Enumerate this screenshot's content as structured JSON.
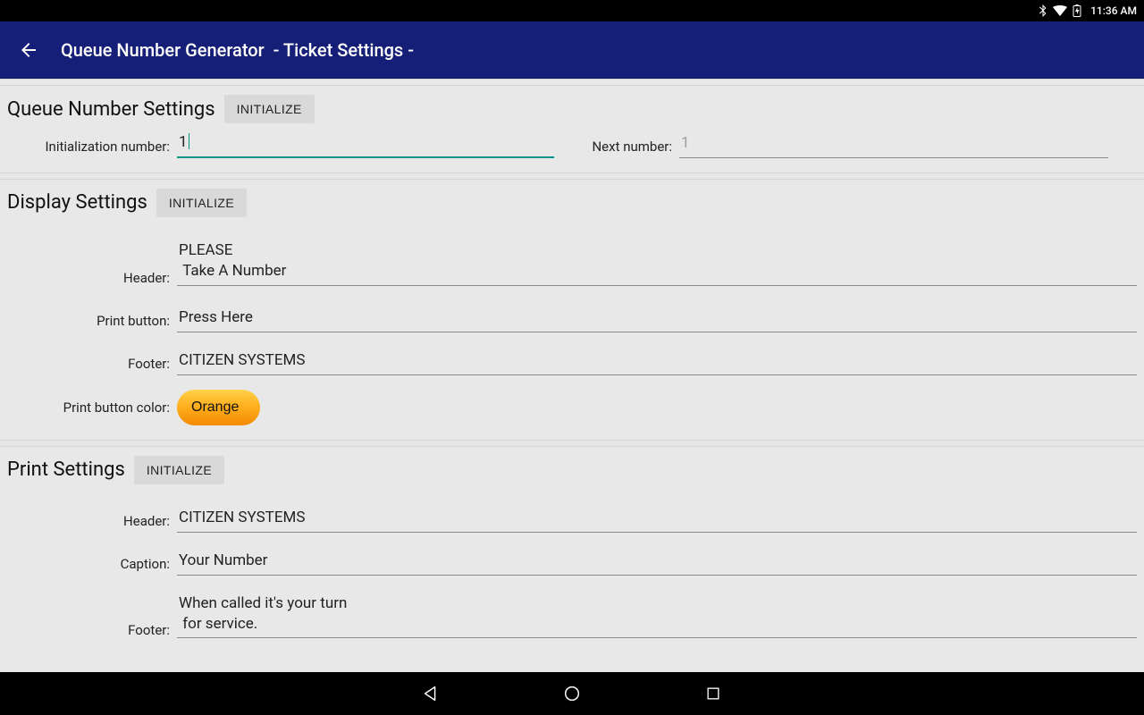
{
  "statusbar": {
    "time": "11:36 AM"
  },
  "appbar": {
    "title": "Queue Number Generator  - Ticket Settings -"
  },
  "buttons": {
    "initialize": "INITIALIZE"
  },
  "queue": {
    "title": "Queue Number Settings",
    "init_num_label": "Initialization number:",
    "init_num_value": "1",
    "next_num_label": "Next number:",
    "next_num_value": "1"
  },
  "display": {
    "title": "Display Settings",
    "header_label": "Header:",
    "header_value": "PLEASE\n Take A Number",
    "print_btn_label": "Print button:",
    "print_btn_value": "Press Here",
    "footer_label": "Footer:",
    "footer_value": "CITIZEN SYSTEMS",
    "color_label": "Print button color:",
    "color_value": "Orange"
  },
  "print": {
    "title": "Print Settings",
    "header_label": "Header:",
    "header_value": "CITIZEN SYSTEMS",
    "caption_label": "Caption:",
    "caption_value": "Your Number",
    "footer_label": "Footer:",
    "footer_value": "When called it's your turn\n for service."
  }
}
